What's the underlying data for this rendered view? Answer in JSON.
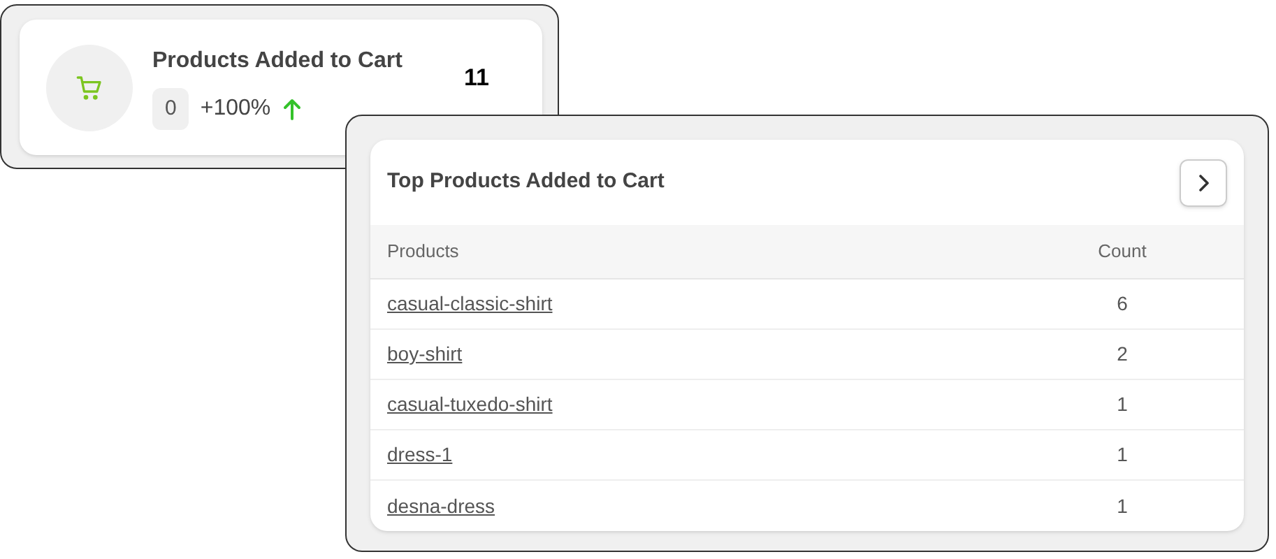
{
  "stat_card": {
    "title": "Products Added to Cart",
    "value": "11",
    "previous": "0",
    "change": "+100%",
    "rising": true
  },
  "top_products": {
    "title": "Top Products Added to Cart",
    "columns": [
      "Products",
      "Count"
    ],
    "rows": [
      {
        "product": "casual-classic-shirt",
        "count": "6"
      },
      {
        "product": "boy-shirt",
        "count": "2"
      },
      {
        "product": "casual-tuxedo-shirt",
        "count": "1"
      },
      {
        "product": "dress-1",
        "count": "1"
      },
      {
        "product": "desna-dress",
        "count": "1"
      }
    ]
  }
}
